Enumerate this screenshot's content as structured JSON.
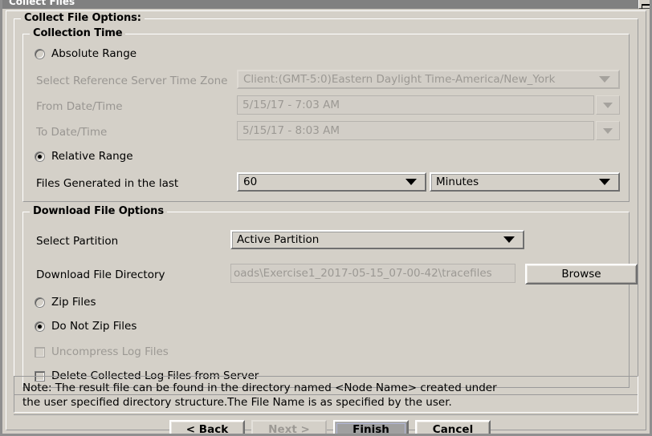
{
  "window": {
    "title": "Collect Files",
    "maximize_icon": "restore-window-icon"
  },
  "collect_group": {
    "title": "Collect File Options:"
  },
  "collection_time": {
    "title": "Collection Time",
    "absolute_range_label": "Absolute Range",
    "absolute_range_selected": false,
    "timezone_label": "Select Reference Server Time Zone",
    "timezone_value": "Client:(GMT-5:0)Eastern Daylight Time-America/New_York",
    "from_label": "From Date/Time",
    "from_value": "5/15/17 - 7:03 AM",
    "to_label": "To Date/Time",
    "to_value": "5/15/17 - 8:03 AM",
    "relative_range_label": "Relative Range",
    "relative_range_selected": true,
    "files_generated_label": "Files Generated in the last",
    "files_generated_amount": "60",
    "files_generated_unit": "Minutes"
  },
  "download_options": {
    "title": "Download File Options",
    "partition_label": "Select Partition",
    "partition_value": "Active Partition",
    "directory_label": "Download File Directory",
    "directory_value": "oads\\Exercise1_2017-05-15_07-00-42\\tracefiles",
    "browse_label": "Browse",
    "zip_files_label": "Zip Files",
    "zip_files_selected": false,
    "do_not_zip_label": "Do Not Zip Files",
    "do_not_zip_selected": true,
    "uncompress_label": "Uncompress Log Files",
    "uncompress_checked": false,
    "delete_collected_label": "Delete Collected Log Files from Server",
    "delete_collected_checked": false
  },
  "note": {
    "line1": "Note: The result file can be found in the directory named <Node Name> created under",
    "line2": "the user specified directory structure.The File Name is as specified by the user."
  },
  "buttons": {
    "back": "< Back",
    "next": "Next >",
    "finish": "Finish",
    "cancel": "Cancel"
  },
  "colors": {
    "window_background": "#d4d0c8",
    "titlebar": "#808080",
    "disabled_text": "#9c9994",
    "focus_ring": "#b3b8d8",
    "selected_button": "#a0a0a0"
  }
}
